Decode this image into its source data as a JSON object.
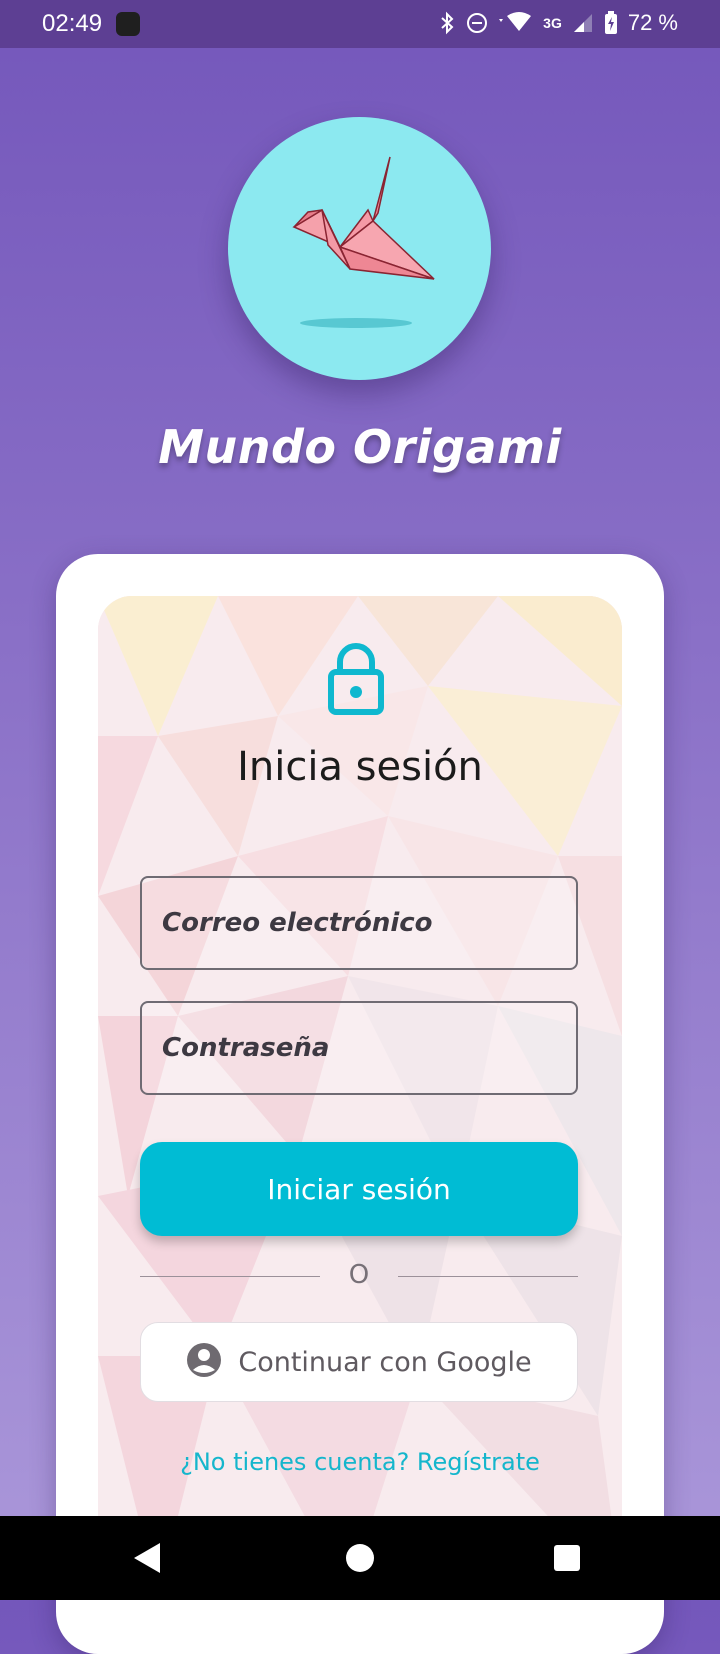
{
  "status_bar": {
    "time": "02:49",
    "network": "3G",
    "battery": "72 %"
  },
  "app": {
    "title": "Mundo Origami",
    "logo_icon": "origami-crane-icon"
  },
  "login": {
    "lock_icon": "lock-icon",
    "title": "Inicia sesión",
    "email_placeholder": "Correo electrónico",
    "email_value": "",
    "password_placeholder": "Contraseña",
    "password_value": "",
    "login_button": "Iniciar sesión",
    "divider_text": "O",
    "google_button": "Continuar con Google",
    "google_icon": "account-circle-icon",
    "signup_link": "¿No tienes cuenta? Regístrate"
  },
  "colors": {
    "background_top": "#7457bb",
    "background_bottom": "#ab98da",
    "status_bar": "#5d3f93",
    "logo_circle": "#8ce9f0",
    "accent": "#00bcd4",
    "link": "#15b6cc"
  },
  "nav_bar": {
    "back_icon": "back-triangle-icon",
    "home_icon": "home-circle-icon",
    "recents_icon": "recents-square-icon"
  }
}
